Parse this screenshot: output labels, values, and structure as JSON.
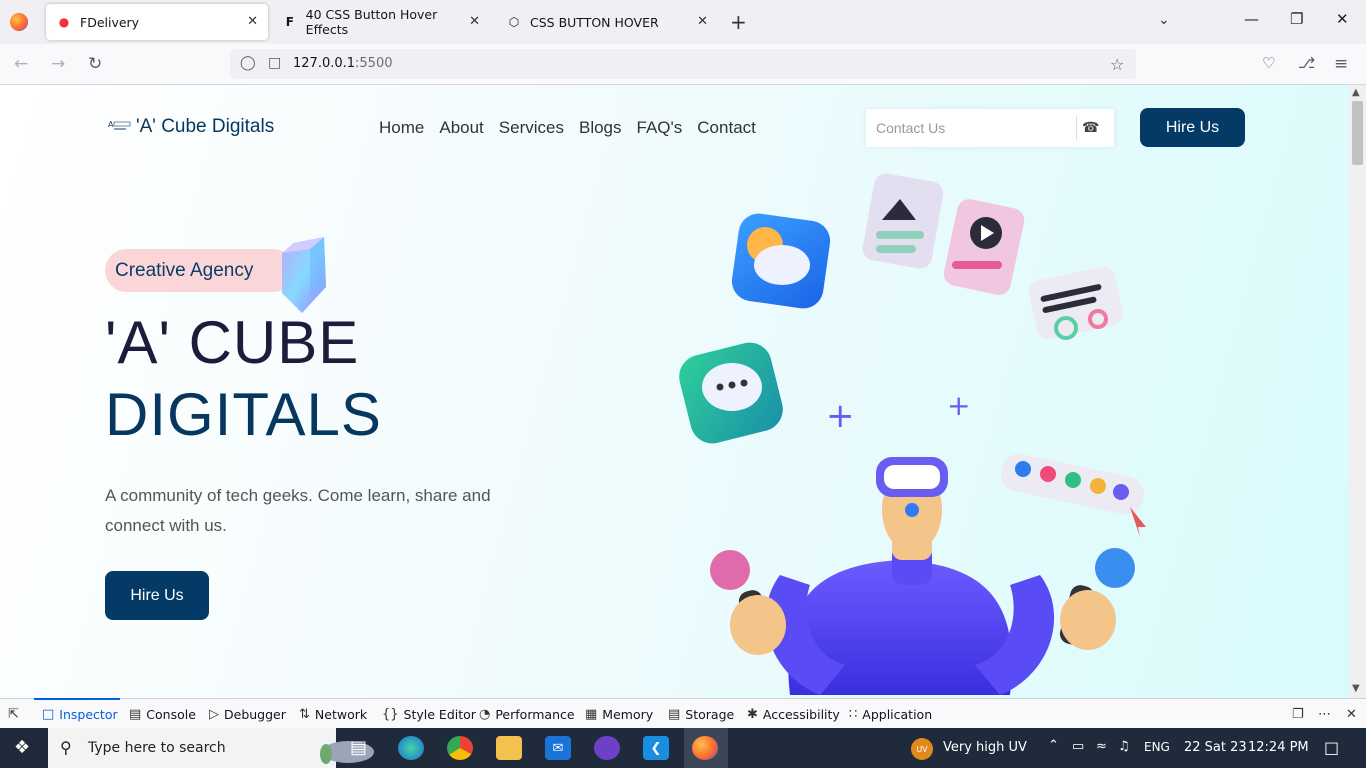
{
  "browser": {
    "tabs": [
      {
        "title": "FDelivery",
        "icon": "fdelivery-icon",
        "active": true
      },
      {
        "title": "40 CSS Button Hover Effects",
        "icon": "f-icon",
        "active": false
      },
      {
        "title": "CSS BUTTON HOVER",
        "icon": "codepen-icon",
        "active": false
      }
    ],
    "url_host": "127.0.0.1",
    "url_port": ":5500"
  },
  "site": {
    "logo_text": "'A' Cube Digitals",
    "nav": [
      "Home",
      "About",
      "Services",
      "Blogs",
      "FAQ's",
      "Contact"
    ],
    "contact_placeholder": "Contact Us",
    "hire_top": "Hire Us",
    "badge": "Creative Agency",
    "headline_line1": "'A' CUBE",
    "headline_line2": "DIGITALS",
    "description": "A community of tech geeks. Come learn, share and connect with us.",
    "hire_main": "Hire Us",
    "colors": {
      "primary": "#053a67",
      "badge_bg": "#fbd6d8",
      "headline_dark": "#1e1c3a"
    }
  },
  "devtools": {
    "tabs": [
      "Inspector",
      "Console",
      "Debugger",
      "Network",
      "Style Editor",
      "Performance",
      "Memory",
      "Storage",
      "Accessibility",
      "Application"
    ],
    "selected": "Inspector"
  },
  "taskbar": {
    "search_placeholder": "Type here to search",
    "uv_badge": "UV",
    "weather": "Very high UV",
    "lang": "ENG",
    "date": "22 Sat 23",
    "time": "12:24 PM"
  }
}
